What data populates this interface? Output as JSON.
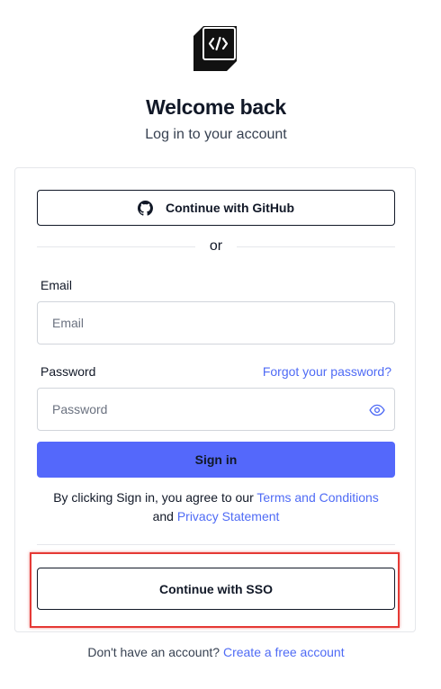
{
  "brand": {
    "logo_icon": "code-brackets-logo-icon"
  },
  "header": {
    "title": "Welcome back",
    "subtitle": "Log in to your account"
  },
  "social": {
    "github_label": "Continue with GitHub",
    "github_icon": "github-icon"
  },
  "divider": {
    "text": "or"
  },
  "form": {
    "email_label": "Email",
    "email_placeholder": "Email",
    "email_value": "",
    "password_label": "Password",
    "password_placeholder": "Password",
    "password_value": "",
    "forgot_link": "Forgot your password?",
    "toggle_icon": "eye-icon",
    "submit_label": "Sign in"
  },
  "legal": {
    "prefix": "By clicking Sign in, you agree to our ",
    "terms_link": "Terms and Conditions",
    "middle": "and ",
    "privacy_link": "Privacy Statement"
  },
  "sso": {
    "label": "Continue with SSO"
  },
  "footer": {
    "text": "Don't have an account? ",
    "link": "Create a free account"
  },
  "colors": {
    "accent": "#5468fb",
    "link": "#4f6bf5",
    "highlight": "#e53935"
  }
}
